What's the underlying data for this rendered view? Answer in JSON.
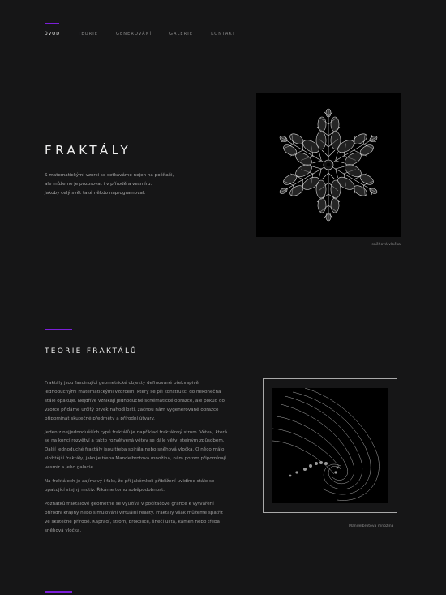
{
  "nav": {
    "items": [
      {
        "label": "ÚVOD"
      },
      {
        "label": "TEORIE"
      },
      {
        "label": "GENEROVÁNÍ"
      },
      {
        "label": "GALERIE"
      },
      {
        "label": "KONTAKT"
      }
    ]
  },
  "hero": {
    "title": "FRAKTÁLY",
    "lines": [
      "S matematickými vzorci se setkáváme nejen na počítači,",
      "ale můžeme je pozorovat i v přírodě a vesmíru.",
      "Jakoby celý svět také někdo naprogramoval."
    ],
    "image_caption": "sněhová vločka"
  },
  "theory": {
    "title": "TEORIE FRAKTÁLŮ",
    "paragraphs": [
      "Fraktály jsou fascinující geometrické objekty definované překvapivě jednoduchými matematickými vzorcem, který se při konstrukci do nekonečna stále opakuje. Nejdříve vznikají jednoduché schématické obrazce, ale pokud do vzorce přidáme určitý prvek nahodilosti, začnou nám vygenerované obrazce připomínat skutečné předměty a přírodní útvary.",
      "Jeden z nejjednodušších typů fraktálů je například fraktálový strom. Větev, která se na konci rozvětví a takto rozvětvená větev se dále větví stejným způsobem. Další jednoduché fraktály jsou třeba spirála nebo sněhová vločka. O něco málo složitější fraktály, jako je třeba Mandelbrotova množina, nám potom připomínají vesmír a jeho galaxie.",
      "Na fraktálech je zajímavý i fakt, že při jakémkoli přiblížení uvidíme stále se opakující stejný motiv. Říkáme tomu soběpodobnost.",
      "Poznatků fraktálové geometrie se využívá v počítačové grafice k vytváření přírodní krajiny nebo simulování virtuální reality. Fraktály však můžeme spatřit i ve skutečné přírodě. Kapradí, strom, brokolice, šnečí ulita, kámen nebo třeba sněhová vločka."
    ],
    "image_caption": "Mandelbrotova množina"
  },
  "colors": {
    "accent": "#7b1fd8",
    "background": "#161617"
  }
}
